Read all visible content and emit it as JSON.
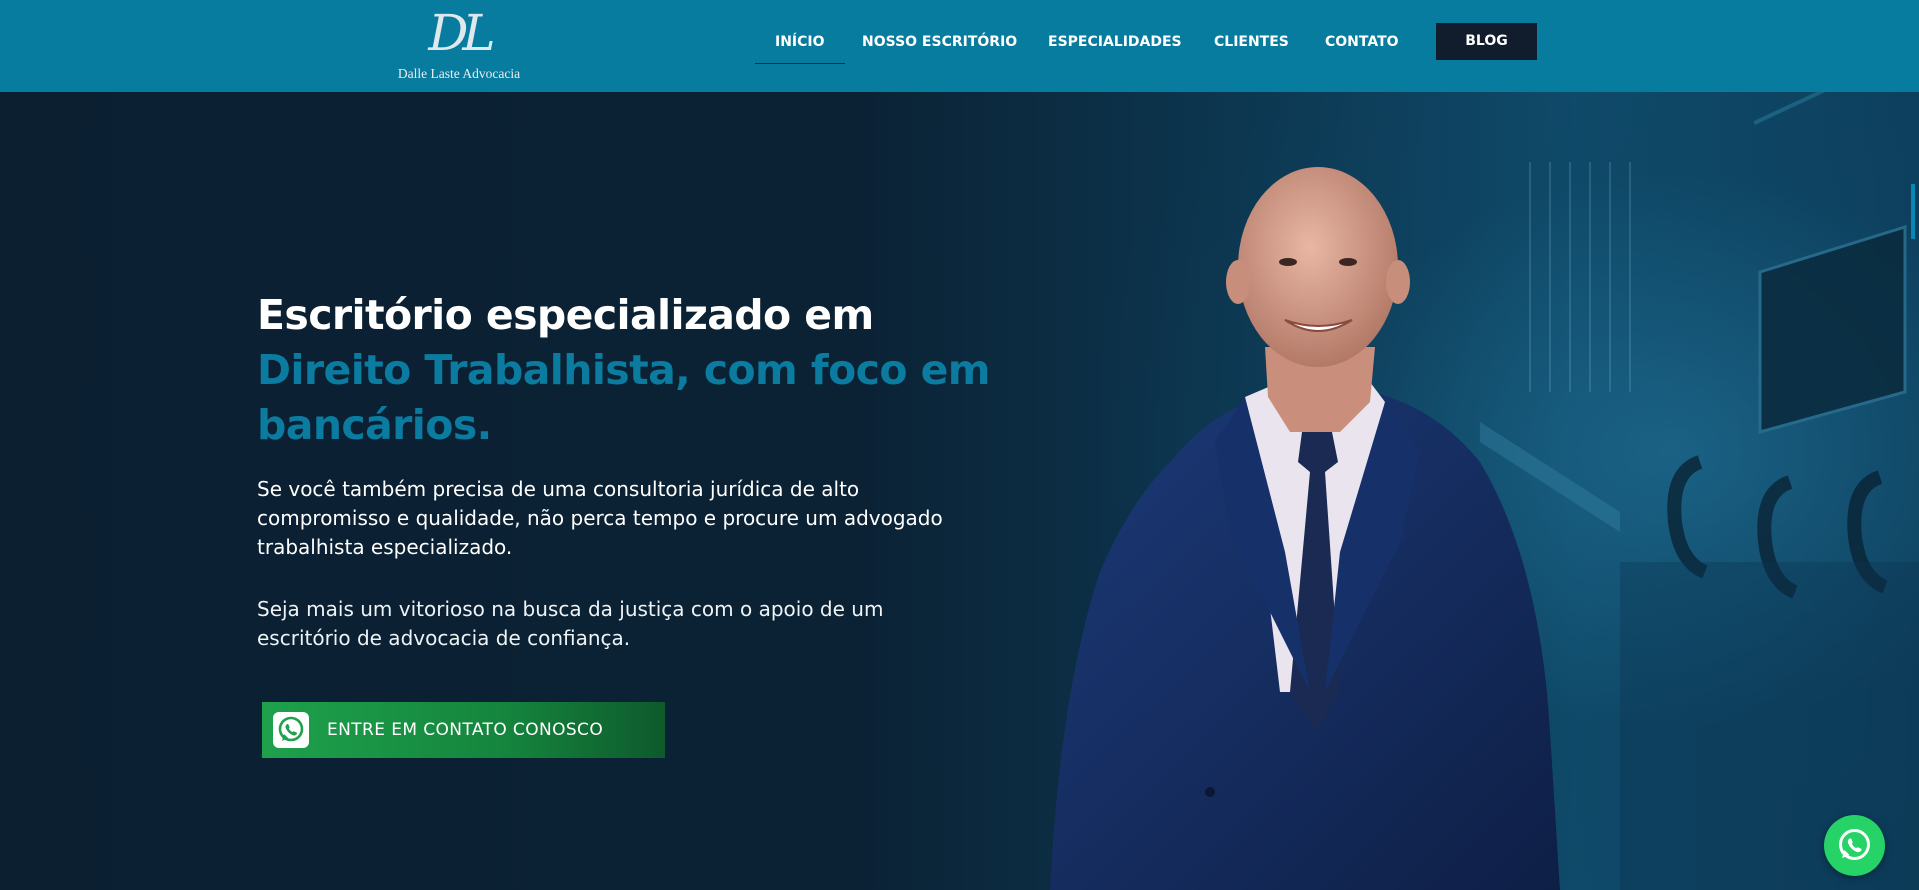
{
  "logo": {
    "mark": "DL",
    "name": "Dalle Laste Advocacia"
  },
  "nav": {
    "items": [
      {
        "label": "INÍCIO"
      },
      {
        "label": "NOSSO ESCRITÓRIO"
      },
      {
        "label": "ESPECIALIDADES"
      },
      {
        "label": "CLIENTES"
      },
      {
        "label": "CONTATO"
      }
    ],
    "blog_label": "BLOG"
  },
  "hero": {
    "title_line1": "Escritório especializado em",
    "title_highlight": "Direito Trabalhista, com foco em bancários.",
    "paragraph1": "Se você também precisa de uma consultoria jurídica de alto compromisso e qualidade, não perca tempo e procure um advogado trabalhista especializado.",
    "paragraph2": "Seja mais um vitorioso na busca da justiça com o apoio de um escritório de advocacia de confiança.",
    "cta_label": "ENTRE EM CONTATO CONOSCO"
  },
  "colors": {
    "header": "#087c9f",
    "hero_bg": "#0b2133",
    "highlight": "#0b7ba0",
    "cta_green": "#1ea14c",
    "whatsapp": "#25d366",
    "blog_bg": "#111c2d"
  },
  "icons": {
    "cta_icon": "whatsapp-icon",
    "float_icon": "whatsapp-icon"
  }
}
